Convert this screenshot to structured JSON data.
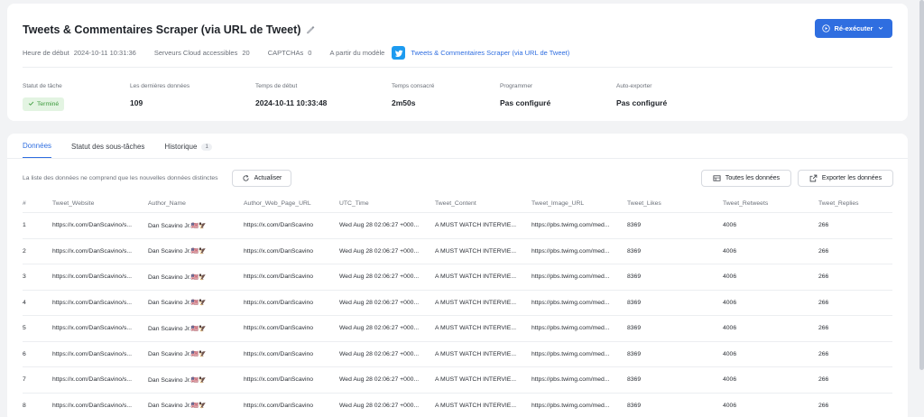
{
  "header": {
    "title": "Tweets & Commentaires Scraper (via URL de Tweet)",
    "meta": [
      {
        "label": "Heure de début",
        "value": "2024-10-11 10:31:36"
      },
      {
        "label": "Serveurs Cloud accessibles",
        "value": "20"
      },
      {
        "label": "CAPTCHAs",
        "value": "0"
      },
      {
        "label": "A partir du modèle",
        "value": ""
      }
    ],
    "model_link": "Tweets & Commentaires Scraper (via URL de Tweet)",
    "rerun_label": "Ré-exécuter"
  },
  "stats": [
    {
      "label": "Statut de tâche",
      "value": "Terminé"
    },
    {
      "label": "Les dernières données",
      "value": "109"
    },
    {
      "label": "Temps de début",
      "value": "2024-10-11 10:33:48"
    },
    {
      "label": "Temps consacré",
      "value": "2m50s"
    },
    {
      "label": "Programmer",
      "value": "Pas configuré"
    },
    {
      "label": "Auto-exporter",
      "value": "Pas configuré"
    }
  ],
  "tabs": [
    {
      "label": "Données"
    },
    {
      "label": "Statut des sous-tâches"
    },
    {
      "label": "Historique",
      "count": "1"
    }
  ],
  "toolbar": {
    "notice": "La liste des données ne comprend que les nouvelles données distinctes",
    "refresh_label": "Actualiser",
    "all_data_label": "Toutes les données",
    "export_label": "Exporter les données"
  },
  "table": {
    "columns": [
      "#",
      "Tweet_Website",
      "Author_Name",
      "Author_Web_Page_URL",
      "UTC_Time",
      "Tweet_Content",
      "Tweet_Image_URL",
      "Tweet_Likes",
      "Tweet_Retweets",
      "Tweet_Replies"
    ],
    "rows": [
      [
        "1",
        "https://x.com/DanScavino/s...",
        "Dan Scavino Jr.🇺🇸🦅",
        "https://x.com/DanScavino",
        "Wed Aug 28 02:06:27 +000...",
        "A MUST WATCH INTERVIE...",
        "https://pbs.twimg.com/med...",
        "8369",
        "4006",
        "266"
      ],
      [
        "2",
        "https://x.com/DanScavino/s...",
        "Dan Scavino Jr.🇺🇸🦅",
        "https://x.com/DanScavino",
        "Wed Aug 28 02:06:27 +000...",
        "A MUST WATCH INTERVIE...",
        "https://pbs.twimg.com/med...",
        "8369",
        "4006",
        "266"
      ],
      [
        "3",
        "https://x.com/DanScavino/s...",
        "Dan Scavino Jr.🇺🇸🦅",
        "https://x.com/DanScavino",
        "Wed Aug 28 02:06:27 +000...",
        "A MUST WATCH INTERVIE...",
        "https://pbs.twimg.com/med...",
        "8369",
        "4006",
        "266"
      ],
      [
        "4",
        "https://x.com/DanScavino/s...",
        "Dan Scavino Jr.🇺🇸🦅",
        "https://x.com/DanScavino",
        "Wed Aug 28 02:06:27 +000...",
        "A MUST WATCH INTERVIE...",
        "https://pbs.twimg.com/med...",
        "8369",
        "4006",
        "266"
      ],
      [
        "5",
        "https://x.com/DanScavino/s...",
        "Dan Scavino Jr.🇺🇸🦅",
        "https://x.com/DanScavino",
        "Wed Aug 28 02:06:27 +000...",
        "A MUST WATCH INTERVIE...",
        "https://pbs.twimg.com/med...",
        "8369",
        "4006",
        "266"
      ],
      [
        "6",
        "https://x.com/DanScavino/s...",
        "Dan Scavino Jr.🇺🇸🦅",
        "https://x.com/DanScavino",
        "Wed Aug 28 02:06:27 +000...",
        "A MUST WATCH INTERVIE...",
        "https://pbs.twimg.com/med...",
        "8369",
        "4006",
        "266"
      ],
      [
        "7",
        "https://x.com/DanScavino/s...",
        "Dan Scavino Jr.🇺🇸🦅",
        "https://x.com/DanScavino",
        "Wed Aug 28 02:06:27 +000...",
        "A MUST WATCH INTERVIE...",
        "https://pbs.twimg.com/med...",
        "8369",
        "4006",
        "266"
      ],
      [
        "8",
        "https://x.com/DanScavino/s...",
        "Dan Scavino Jr.🇺🇸🦅",
        "https://x.com/DanScavino",
        "Wed Aug 28 02:06:27 +000...",
        "A MUST WATCH INTERVIE...",
        "https://pbs.twimg.com/med...",
        "8369",
        "4006",
        "266"
      ]
    ]
  },
  "colors": {
    "accent": "#2f6ee0",
    "twitter": "#1d9bf0",
    "success_bg": "#e3f4e2",
    "success_text": "#3c9a3c"
  },
  "icons": {
    "edit": "pencil-icon",
    "rerun": "play-circle-icon",
    "refresh": "refresh-icon",
    "all_data": "table-icon",
    "export": "export-icon",
    "twitter": "twitter-icon",
    "done": "check-icon"
  }
}
